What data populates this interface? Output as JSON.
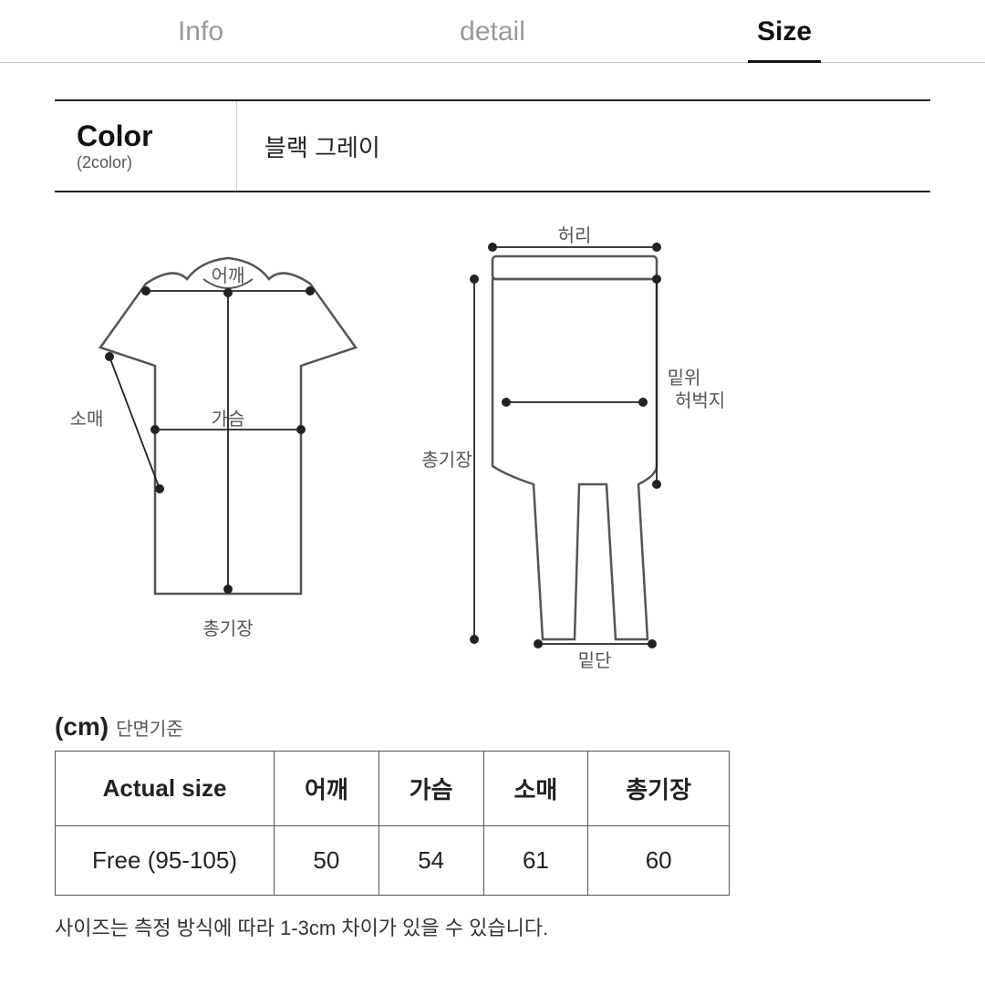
{
  "tabs": [
    {
      "id": "info",
      "label": "Info",
      "active": false
    },
    {
      "id": "detail",
      "label": "detail",
      "active": false
    },
    {
      "id": "size",
      "label": "Size",
      "active": true
    }
  ],
  "color": {
    "title": "Color",
    "sub": "(2color)",
    "value": "블랙  그레이"
  },
  "diagram": {
    "tshirt_labels": {
      "shoulder": "어깨",
      "chest": "가슴",
      "sleeve": "소매",
      "total_length": "총기장"
    },
    "pants_labels": {
      "waist": "허리",
      "above_knee": "밑위",
      "thigh": "허벅지",
      "total_length": "총기장",
      "hem": "밑단"
    }
  },
  "size_table": {
    "unit_label": "(cm)",
    "unit_sub": "단면기준",
    "headers": [
      "Actual size",
      "어깨",
      "가슴",
      "소매",
      "총기장"
    ],
    "rows": [
      [
        "Free (95-105)",
        "50",
        "54",
        "61",
        "60"
      ]
    ]
  },
  "disclaimer": "사이즈는 측정 방식에 따라 1-3cm 차이가 있을 수 있습니다."
}
